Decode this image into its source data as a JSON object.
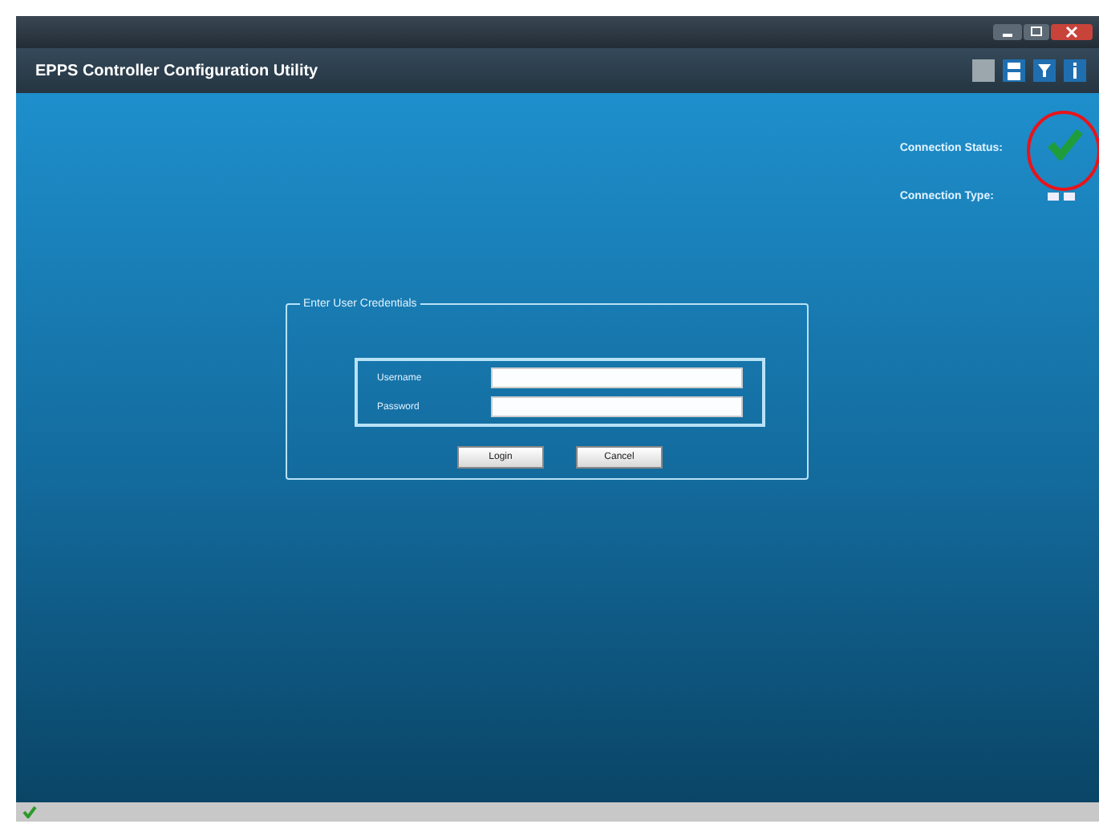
{
  "window": {
    "title": "EPPS Controller Configuration Utility"
  },
  "connection": {
    "status_label": "Connection Status:",
    "status_ok": true,
    "type_label": "Connection Type:"
  },
  "credentials": {
    "legend": "Enter User Credentials",
    "fields": [
      {
        "label": "Username"
      },
      {
        "label": "Password"
      }
    ],
    "buttons": [
      "Login",
      "Cancel"
    ]
  }
}
